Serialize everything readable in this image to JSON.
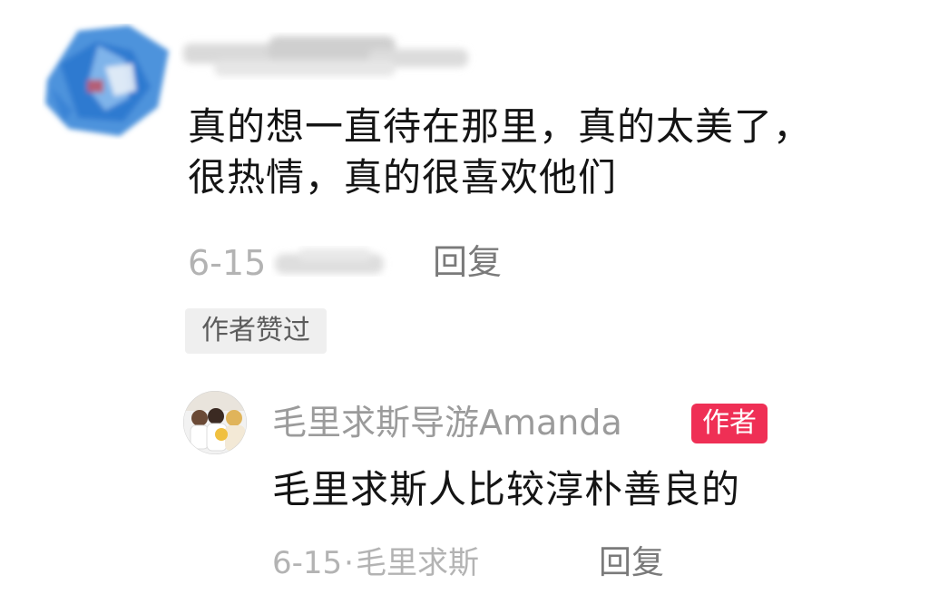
{
  "comment": {
    "avatar_icon": "blurred-user-avatar",
    "text_line1": "真的想一直待在那里，真的太美了，",
    "text_line2": "很热情，真的很喜欢他们",
    "date": "6-15",
    "reply_label": "回复",
    "liked_badge": "作者赞过"
  },
  "reply": {
    "avatar_icon": "author-avatar",
    "name": "毛里求斯导游Amanda",
    "author_tag": "作者",
    "text": "毛里求斯人比较淳朴善良的",
    "date": "6-15",
    "separator": "·",
    "location": "毛里求斯",
    "reply_label": "回复"
  },
  "colors": {
    "author_tag_bg": "#ef2f55",
    "meta_gray": "#b3b3b3",
    "text_dark": "#141414"
  }
}
